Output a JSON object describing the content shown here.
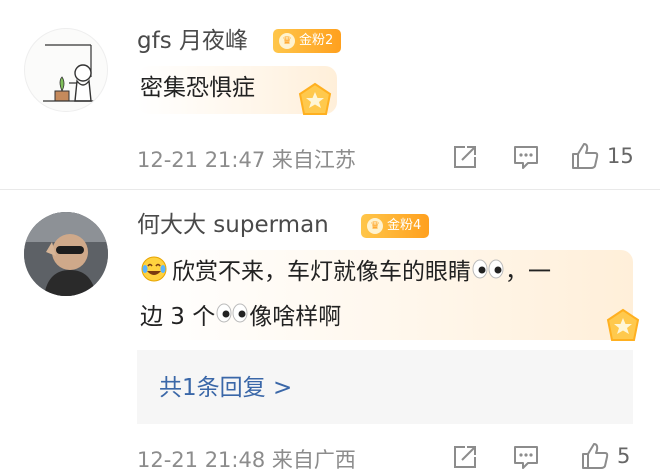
{
  "comments": [
    {
      "username": "gfs 月夜峰",
      "badge": "金粉2",
      "content": "密集恐惧症",
      "timestamp": "12-21 21:47",
      "location": "来自江苏",
      "like_count": "15"
    },
    {
      "username": "何大大 superman",
      "badge": "金粉4",
      "content_part1": "欣赏不来，车灯就像车的眼睛",
      "content_part2": "，一",
      "content_part3": "边 3 个",
      "content_part4": "像啥样啊",
      "reply_link": "共1条回复 >",
      "timestamp": "12-21 21:48",
      "location": "来自广西",
      "like_count": "5"
    }
  ],
  "icons": {
    "share": "share-icon",
    "comment": "comment-icon",
    "like": "thumb-up-icon",
    "medal": "gold-medal-icon",
    "emoji": "laugh-cry-emoji-icon",
    "eyes": "eyes-emoji-icon"
  },
  "colors": {
    "badge": "#ffa01e",
    "reply_link": "#3a67a8",
    "meta": "#8c8c8c"
  }
}
